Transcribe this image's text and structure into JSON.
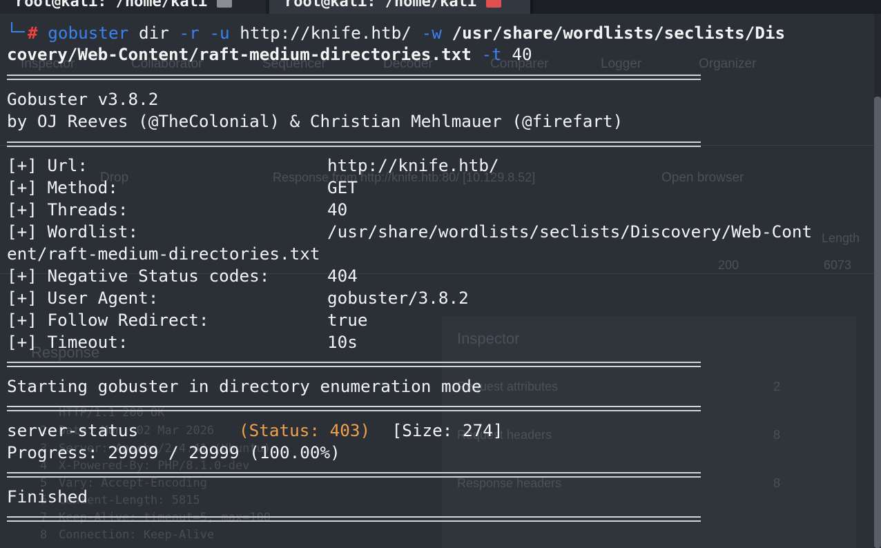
{
  "tabs": [
    {
      "title": "root@kali: /home/kali",
      "active": false,
      "button_color": "#8a8d92"
    },
    {
      "title": "root@kali: /home/kali",
      "active": true,
      "button_color": "#e05050"
    }
  ],
  "background_app": {
    "tabs": [
      "Inspector",
      "Collaborator",
      "Sequencer",
      "Decoder",
      "Comparer",
      "Logger",
      "Organizer"
    ],
    "toolbar": {
      "dropdown_label": "Drop",
      "response_from": "Response from http://knife.htb:80/ [10.129.8.52]",
      "open_browser": "Open browser"
    },
    "table": {
      "status": "200",
      "length": "6073",
      "length_header": "Length"
    },
    "response_label": "Response",
    "inspector": {
      "title": "Inspector",
      "rows": [
        {
          "label": "Request attributes",
          "count": "2"
        },
        {
          "label": "Request headers",
          "count": "8"
        },
        {
          "label": "Response headers",
          "count": "8"
        }
      ]
    },
    "response_lines": [
      "HTTP/1.1 200 OK",
      "Date: Mon, 02 Mar 2026",
      "Server: Apache/2.4.41 (Ubuntu)",
      "X-Powered-By: PHP/8.1.0-dev",
      "Vary: Accept-Encoding",
      "Content-Length: 5815",
      "Keep-Alive: timeout=5, max=100",
      "Connection: Keep-Alive"
    ],
    "line_numbers": [
      "2",
      "3",
      "4",
      "5",
      "6",
      "7",
      "8"
    ]
  },
  "terminal": {
    "prompt_symbol": "#",
    "command": {
      "program": "gobuster",
      "subcommand": " dir ",
      "flag_r": "-r",
      "flag_u": "-u",
      "url": " http://knife.htb/ ",
      "flag_w": "-w",
      "wordlist_part1": " /usr/share/wordlists/seclists/Dis",
      "wordlist_part2": "covery/Web-Content/raft-medium-directories.txt",
      "flag_t": "-t",
      "threads": " 40"
    },
    "banner": {
      "version": "Gobuster v3.8.2",
      "authors": "by OJ Reeves (@TheColonial) & Christian Mehlmauer (@firefart)"
    },
    "config": {
      "url_key": "[+] Url:",
      "url_value": "http://knife.htb/",
      "method_key": "[+] Method:",
      "method_value": "GET",
      "threads_key": "[+] Threads:",
      "threads_value": "40",
      "wordlist_key": "[+] Wordlist:",
      "wordlist_value": "/usr/share/wordlists/seclists/Discovery/Web-Cont",
      "wordlist_cont": "ent/raft-medium-directories.txt",
      "negative_key": "[+] Negative Status codes:",
      "negative_value": "404",
      "agent_key": "[+] User Agent:",
      "agent_value": "gobuster/3.8.2",
      "redirect_key": "[+] Follow Redirect:",
      "redirect_value": "true",
      "timeout_key": "[+] Timeout:",
      "timeout_value": "10s"
    },
    "start_message": "Starting gobuster in directory enumeration mode",
    "result": {
      "path": "server-status",
      "status": "(Status: 403)",
      "size": " [Size: 274]"
    },
    "progress": "Progress: 29999 / 29999 (100.00%)",
    "finished": "Finished"
  },
  "colors": {
    "terminal_bg": "#2b2f36",
    "text": "#f4f4f4",
    "command_blue": "#3c82f0",
    "prompt_red": "#f04040",
    "status_orange": "#f0a14d",
    "rule": "#d6d6d6"
  }
}
